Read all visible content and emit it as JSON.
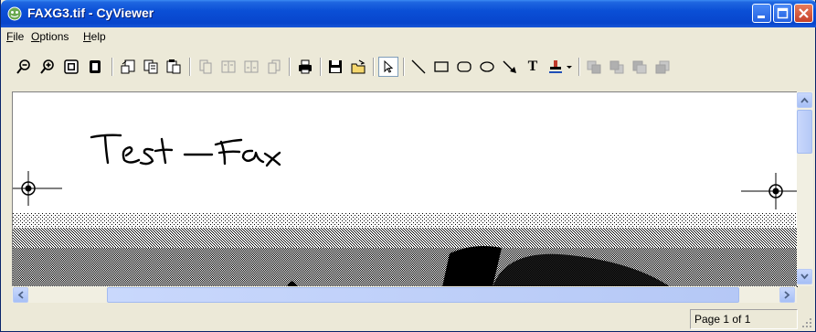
{
  "window": {
    "title": "FAXG3.tif - CyViewer"
  },
  "menu": [
    {
      "label": "File",
      "hotkey": "F",
      "rest": "ile"
    },
    {
      "label": "Options",
      "hotkey": "O",
      "rest": "ptions"
    },
    {
      "label": "Help",
      "hotkey": "H",
      "rest": "elp"
    }
  ],
  "toolbar": {
    "buttons": [
      "zoom-out",
      "zoom-in",
      "fit-page",
      "fit-width",
      "rotate-left",
      "copy",
      "paste",
      "page-first",
      "page-prev",
      "page-next",
      "page-last",
      "print",
      "save",
      "open",
      "select",
      "line",
      "rectangle",
      "rounded-rectangle",
      "ellipse",
      "arrow",
      "text",
      "stamp",
      "stamp-dropdown",
      "layer-1",
      "layer-2",
      "layer-3",
      "layer-4"
    ],
    "text_tool_label": "T"
  },
  "document": {
    "handwriting": "Test - Fax"
  },
  "status": {
    "page": "Page 1 of 1"
  },
  "colors": {
    "title_bar": "#0a4fd6",
    "window_bg": "#ece9d8",
    "close_button": "#c5412a"
  }
}
